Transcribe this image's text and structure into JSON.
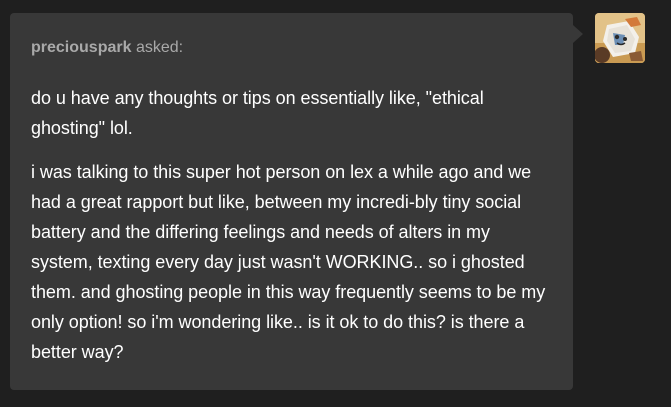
{
  "ask": {
    "asker_name": "preciouspark",
    "asked_label": "asked:",
    "paragraphs": [
      "do u have any thoughts or tips on essentially like, \"ethical ghosting\" lol.",
      "i was talking to this super hot person on lex a while ago and we had a great rapport but like, between my incredi-bly tiny social battery and the differing feelings and needs of alters in my system, texting every day just wasn't WORKING.. so i ghosted them. and ghosting people in this way frequently seems to be my only option! so i'm wondering like.. is it ok to do this? is there a better way?"
    ]
  },
  "avatar": {
    "icon": "asker-avatar-illustration"
  },
  "colors": {
    "page_bg": "#1f1f1f",
    "card_bg": "#383838",
    "asker_text": "#a9a9a9",
    "body_text": "#ffffff"
  }
}
